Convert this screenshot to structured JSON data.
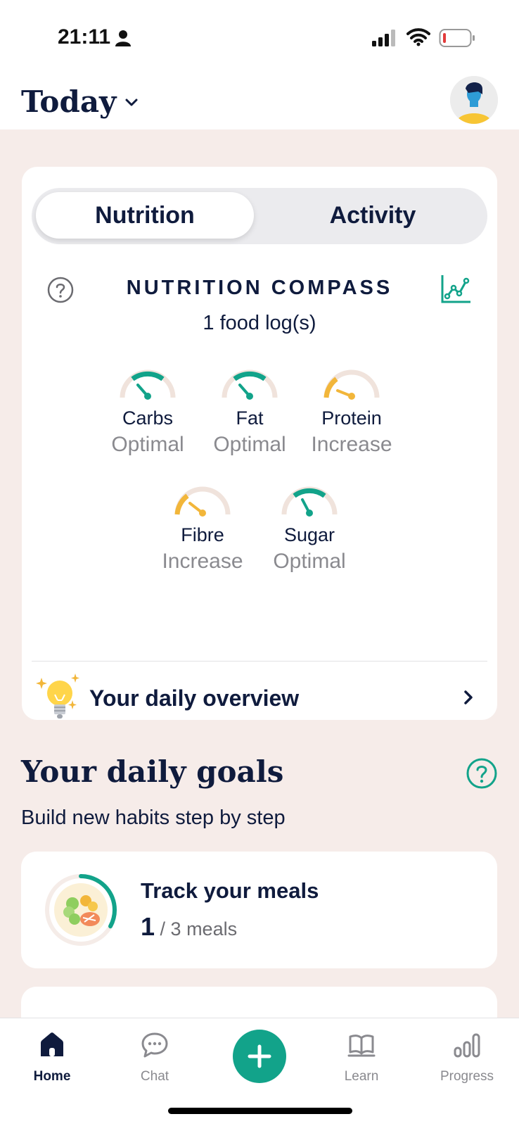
{
  "status_bar": {
    "time": "21:11",
    "icons": [
      "person-icon",
      "signal-icon",
      "wifi-icon",
      "battery-icon"
    ]
  },
  "header": {
    "title": "Today",
    "chevron_icon": "chevron-down-icon",
    "avatar_icon": "avatar"
  },
  "segmented": {
    "tabs": [
      {
        "label": "Nutrition",
        "active": true
      },
      {
        "label": "Activity",
        "active": false
      }
    ]
  },
  "compass": {
    "title": "NUTRITION COMPASS",
    "subtitle": "1 food log(s)",
    "icons": [
      "help-icon",
      "line-chart-icon"
    ],
    "gauges": [
      {
        "name": "Carbs",
        "status": "Optimal",
        "color": "#12a38a",
        "level": "optimal"
      },
      {
        "name": "Fat",
        "status": "Optimal",
        "color": "#12a38a",
        "level": "optimal"
      },
      {
        "name": "Protein",
        "status": "Increase",
        "color": "#f2b63a",
        "level": "low"
      },
      {
        "name": "Fibre",
        "status": "Increase",
        "color": "#f2b63a",
        "level": "low"
      },
      {
        "name": "Sugar",
        "status": "Optimal",
        "color": "#12a38a",
        "level": "optimal"
      }
    ],
    "overview_label": "Your daily overview"
  },
  "goals": {
    "title": "Your daily goals",
    "subtitle": "Build new habits step by step",
    "meal_card": {
      "title": "Track your meals",
      "count": "1",
      "total": "/ 3 meals",
      "progress": 0.33
    }
  },
  "bottom_nav": {
    "items": [
      {
        "label": "Home",
        "icon": "home-icon",
        "active": true
      },
      {
        "label": "Chat",
        "icon": "chat-icon",
        "active": false
      },
      {
        "label": "",
        "icon": "plus-icon",
        "active": false
      },
      {
        "label": "Learn",
        "icon": "book-icon",
        "active": false
      },
      {
        "label": "Progress",
        "icon": "bar-chart-icon",
        "active": false
      }
    ]
  },
  "colors": {
    "accent": "#12a38a",
    "warning": "#f2b63a",
    "navy": "#0f1b3d",
    "background_tint": "#f6ece9",
    "gauge_track": "#f0e3dc"
  }
}
